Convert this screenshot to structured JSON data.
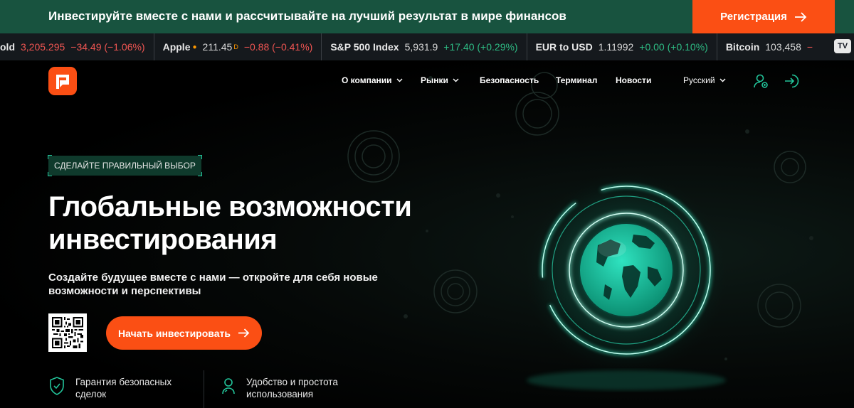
{
  "promo": {
    "text": "Инвестируйте вместе с нами и рассчитывайте на лучший результат в мире финансов",
    "button_label": "Регистрация"
  },
  "ticker": [
    {
      "symbol": "old",
      "price": "3,205.295",
      "change": "−34.49 (−1.06%)",
      "dir": "down"
    },
    {
      "symbol": "Apple",
      "price": "211.45",
      "marker": "D",
      "change": "−0.88 (−0.41%)",
      "dir": "down"
    },
    {
      "symbol": "S&P 500 Index",
      "price": "5,931.9",
      "change": "+17.40 (+0.29%)",
      "dir": "up"
    },
    {
      "symbol": "EUR to USD",
      "price": "1.11992",
      "change": "+0.00 (+0.10%)",
      "dir": "up"
    },
    {
      "symbol": "Bitcoin",
      "price": "103,458",
      "change": "−",
      "dir": "down"
    }
  ],
  "nav": {
    "company": "О компании",
    "markets": "Рынки",
    "security": "Безопасность",
    "terminal": "Терминал",
    "news": "Новости",
    "language": "Русский"
  },
  "hero": {
    "eyebrow": "СДЕЛАЙТЕ ПРАВИЛЬНЫЙ ВЫБОР",
    "headline_line1": "Глобальные возможности",
    "headline_line2": "инвестирования",
    "subtitle_line1": "Создайте будущее вместе с нами — откройте для себя новые",
    "subtitle_line2": "возможности и перспективы",
    "cta_label": "Начать инвестировать"
  },
  "features": [
    {
      "line1": "Гарантия безопасных",
      "line2": "сделок",
      "icon": "shield-check-icon"
    },
    {
      "line1": "Удобство и простота",
      "line2": "использования",
      "icon": "user-support-icon"
    }
  ],
  "colors": {
    "accent": "#fb4f14",
    "promo_bg": "#18533f",
    "teal": "#22c49a",
    "ticker_bg": "#15191d"
  }
}
